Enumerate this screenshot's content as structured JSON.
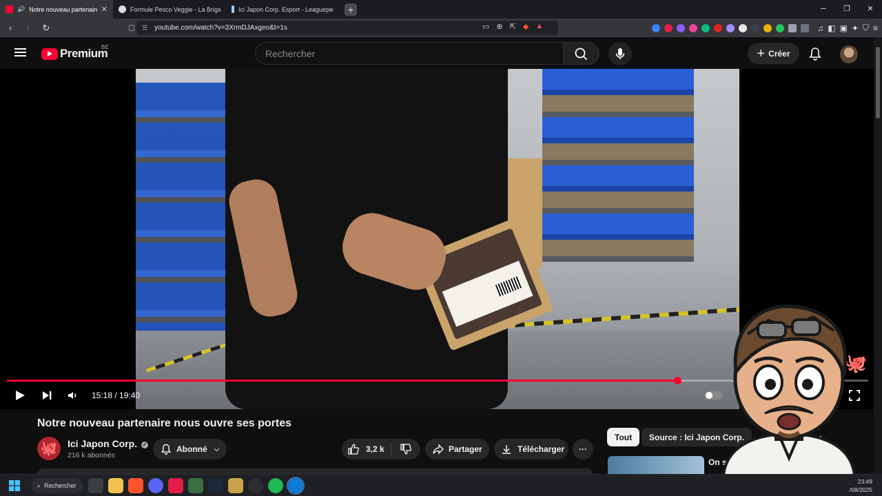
{
  "browser": {
    "tabs": [
      {
        "title": "Notre nouveau partenaire nous ouvre ses portes",
        "active": true,
        "favicon_color": "#ff0033"
      },
      {
        "title": "Formule Pesco Veggie - La Brigade de Buitoni",
        "active": false,
        "favicon_color": "#e0e0e0"
      },
      {
        "title": "Ici Japon Corp. Esport - Leaguepedia",
        "active": false,
        "favicon_color": "#9ecbff"
      }
    ],
    "new_tab_label": "+",
    "url": "youtube.com/watch?v=3XrmDJAxgeo&t=1s",
    "window_controls": {
      "minimize": "─",
      "restore": "❐",
      "close": "✕"
    }
  },
  "youtube": {
    "logo_text": "Premium",
    "country_code": "BE",
    "search_placeholder": "Rechercher",
    "create_label": "Créer"
  },
  "player": {
    "current_time": "15:18",
    "duration": "19:40",
    "time_display": "15:18 / 19:40",
    "progress_fraction": 0.778
  },
  "video": {
    "title": "Notre nouveau partenaire nous ouvre ses portes",
    "channel_name": "Ici Japon Corp.",
    "subscribers": "216 k abonnés",
    "subscribe_label": "Abonné",
    "likes": "3,2 k",
    "share_label": "Partager",
    "download_label": "Télécharger",
    "more_label": "···"
  },
  "sidebar": {
    "chips": [
      {
        "label": "Tout",
        "selected": true
      },
      {
        "label": "Source : Ici Japon Corp.",
        "selected": false
      }
    ],
    "first_related_title": "On s"
  },
  "taskbar": {
    "search_label": "Rechercher",
    "clock_time": "23:49",
    "clock_date": "/08/2025"
  },
  "colors": {
    "yt_red": "#ff0033",
    "bg": "#0f0f0f",
    "pill": "#272727"
  }
}
